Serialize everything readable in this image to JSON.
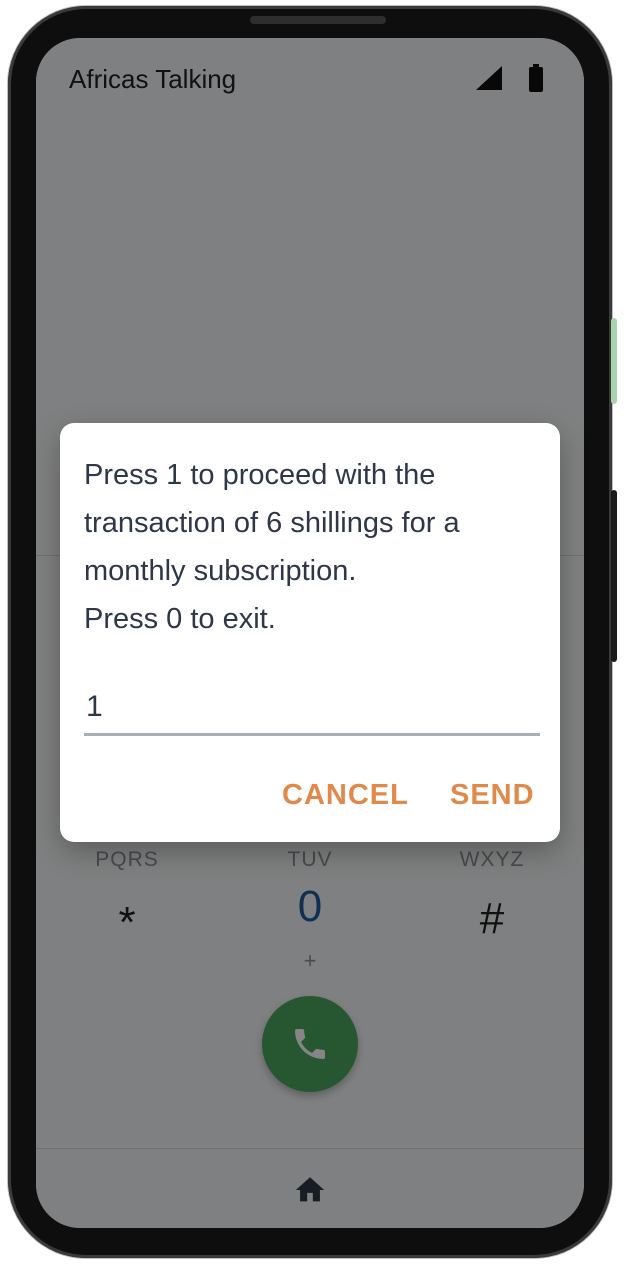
{
  "status_bar": {
    "app_title": "Africas Talking",
    "icons": [
      "signal-icon",
      "battery-icon"
    ]
  },
  "keypad": {
    "keys": [
      {
        "letters": "PQRS",
        "main": "*",
        "sub": ""
      },
      {
        "letters": "TUV",
        "main": "0",
        "sub": "+"
      },
      {
        "letters": "WXYZ",
        "main": "#",
        "sub": ""
      }
    ],
    "call_icon": "phone-icon"
  },
  "nav_bar": {
    "home_icon": "home-icon"
  },
  "dialog": {
    "message": "Press 1 to proceed with the\ntransaction of 6 shillings for a\nmonthly subscription.\nPress 0 to exit.",
    "input_value": "1",
    "cancel_label": "CANCEL",
    "send_label": "SEND"
  },
  "colors": {
    "accent": "#e0894a",
    "call_green": "#4ca85e",
    "text_dark": "#2d3748"
  }
}
